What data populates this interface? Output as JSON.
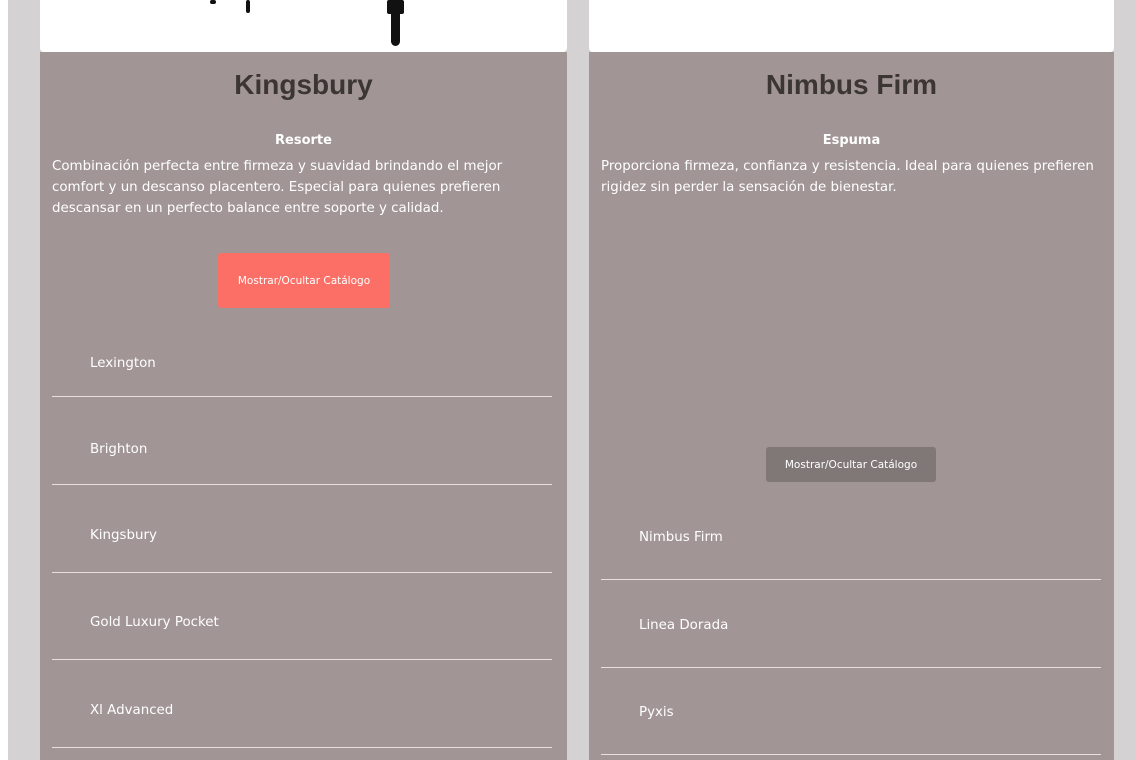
{
  "cards": [
    {
      "title": "Kingsbury",
      "type": "Resorte",
      "description": "Combinación perfecta entre firmeza y suavidad brindando el mejor comfort y un descanso placentero. Especial para quienes prefieren descansar en un perfecto balance entre soporte y calidad.",
      "toggle_label": "Mostrar/Ocultar Catálogo",
      "items": [
        "Lexington",
        "Brighton",
        "Kingsbury",
        "Gold Luxury Pocket",
        "Xl Advanced"
      ]
    },
    {
      "title": "Nimbus Firm",
      "type": "Espuma",
      "description": "Proporciona firmeza, confianza y resistencia. Ideal para quienes prefieren rigidez sin perder la sensación de bienestar.",
      "toggle_label": "Mostrar/Ocultar Catálogo",
      "items": [
        "Nimbus Firm",
        "Linea Dorada",
        "Pyxis"
      ]
    }
  ],
  "colors": {
    "card_bg": "#a19595",
    "page_bg": "#d4d2d3",
    "button_active": "#fb6f66",
    "button_muted": "#807777",
    "title_text": "#3b3534"
  }
}
